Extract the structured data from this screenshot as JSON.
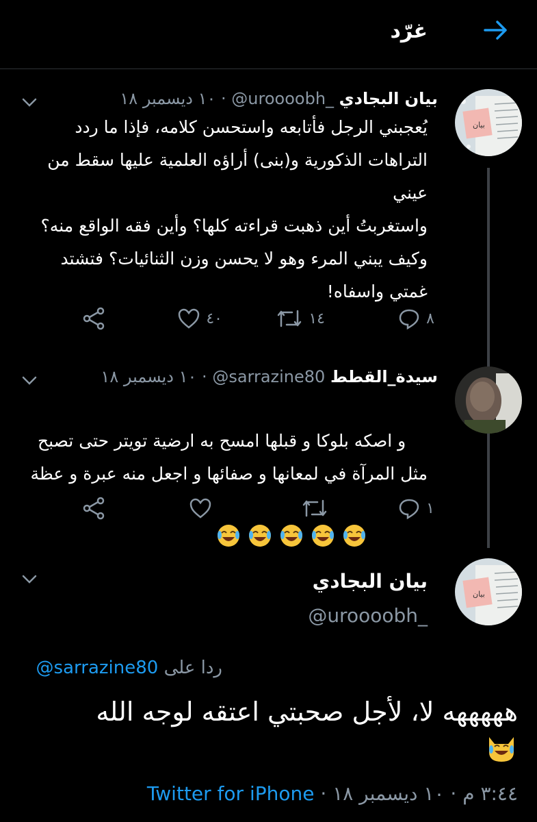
{
  "header": {
    "title": "غرّد",
    "accent": "#1d9bf0"
  },
  "tweets": [
    {
      "name": "بيان البجادي",
      "handle": "@uroooobh_",
      "dot": "·",
      "date": "١٠ ديسمبر ١٨",
      "text": "يُعجبني الرجل فأتابعه واستحسن كلامه، فإذا ما ردد التراهات الذكورية و(بنى) أراؤه العلمية عليها سقط من عيني\nواستغربتُ أين ذهبت قراءته كلها؟ وأين فقه الواقع منه؟ وكيف يبني المرء وهو لا يحسن وزن الثنائيات؟ فتشتد غمتي واسفاه!",
      "replies": "٨",
      "retweets": "١٤",
      "likes": "٤٠"
    },
    {
      "name": "سيدة_القطط",
      "handle": "@sarrazine80",
      "dot": "·",
      "date": "١٠ ديسمبر ١٨",
      "text": "و اصكه بلوكا و قبلها امسح به ارضية تويتر حتى تصبح مثل المرآة في لمعانها و صفائها و اجعل منه عبرة و عظة",
      "replies": "١",
      "retweets": "",
      "likes": ""
    }
  ],
  "main": {
    "name": "بيان البجادي",
    "handle": "@uroooobh_",
    "reply_label": "ردا على",
    "reply_to": "@sarrazine80",
    "text": "هههههه لا، لأجل صحبتي اعتقه لوجه الله",
    "time": "٣:٤٤ م · ١٠ ديسمبر ١٨ ·",
    "source": "Twitter for iPhone"
  },
  "colors": {
    "muted": "#8b98a5",
    "link": "#1d9bf0",
    "background": "#000000"
  }
}
